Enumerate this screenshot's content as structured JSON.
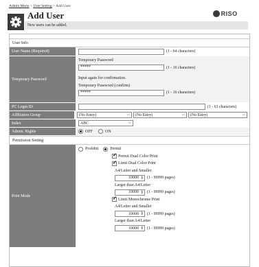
{
  "breadcrumb": {
    "link1": "Admin Menu",
    "sep1": " > ",
    "link2": "User Setting",
    "sep2": " > ",
    "current": "Add User"
  },
  "header": {
    "title": "Add User",
    "subtitle": "New users can be added.",
    "logo_text": "RISO"
  },
  "sections": {
    "user_info": "User Info",
    "permission": "Permission Setting"
  },
  "fields": {
    "user_name": {
      "label": "User Name (Required)",
      "value": "",
      "hint": "(1 - 64 characters)"
    },
    "temp_password": {
      "label": "Temporary Password",
      "caption": "Temporary Password",
      "value": "*****",
      "hint": "(1 - 16 characters)",
      "again": "Input again for confirmation.",
      "confirm_caption": "Temporary Password (confirm)",
      "confirm_value": "*****",
      "confirm_hint": "(1 - 16 characters)"
    },
    "pc_login": {
      "label": "PC Login ID",
      "value": "",
      "hint": "(1 - 63 characters)"
    },
    "affiliation": {
      "label": "Affiliation Group",
      "options": [
        "(No Entry)",
        "(No Entry)",
        "(No Entry)"
      ]
    },
    "index": {
      "label": "Index",
      "value": "ABC"
    },
    "admin_rights": {
      "label": "Admin. Rights",
      "off": "OFF",
      "on": "ON",
      "selected": "OFF"
    }
  },
  "print_mode": {
    "label": "Print Mode",
    "prohibit": "Prohibit",
    "permit": "Permit",
    "permit_dual": "Permit Dual Color Print",
    "limit_dual": "Limit Dual Color Print",
    "a4_smaller": "A4/Letter and Smaller",
    "a4_larger": "Larger than A4/Letter",
    "limit_mono": "Limit Monochrome Print",
    "a4_smaller2": "A4/Letter and Smaller",
    "a4_larger2": "Larger than A4/Letter",
    "count1": "10000",
    "count2": "10000",
    "count3": "10000",
    "count4": "10000",
    "range": "(1 - 99999 pages)"
  },
  "icons": [
    "gear-icon",
    "spinner-icon",
    "chevron-down-icon",
    "riso-logo-icon"
  ]
}
